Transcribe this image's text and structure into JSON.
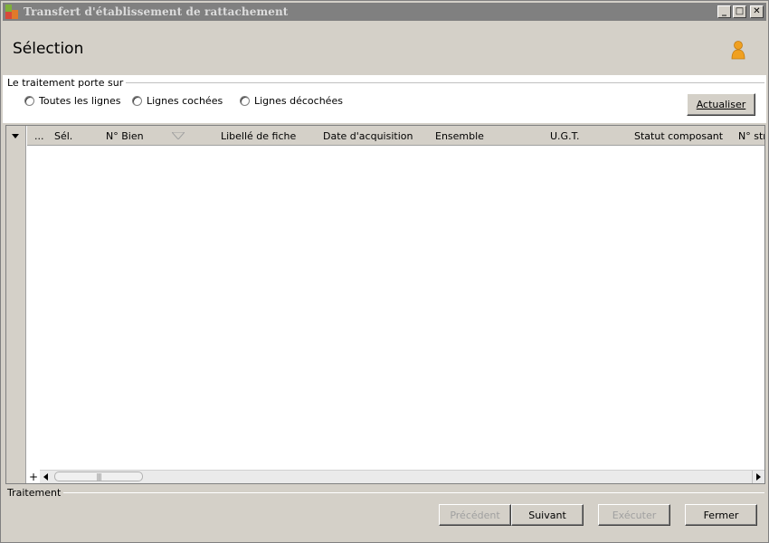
{
  "window": {
    "title": "Transfert d'établissement de rattachement",
    "controls": [
      "_",
      "□",
      "✕"
    ]
  },
  "header": {
    "title": "Sélection",
    "user_icon": "user-icon"
  },
  "scope": {
    "legend": "Le traitement porte sur",
    "options": [
      "Toutes les lignes",
      "Lignes cochées",
      "Lignes décochées"
    ],
    "refresh_label": "Actualiser"
  },
  "grid": {
    "columns": [
      "...",
      "Sél.",
      "N° Bien",
      "Libellé de fiche",
      "Date d'acquisition",
      "Ensemble",
      "U.G.T.",
      "Statut composant",
      "N° str"
    ],
    "rows": [],
    "add_label": "+",
    "scroll_thumb_grip": "|||"
  },
  "process": {
    "legend": "Traitement",
    "buttons": {
      "previous": "Précédent",
      "next": "Suivant",
      "execute": "Exécuter",
      "close": "Fermer"
    }
  },
  "colors": {
    "face": "#d4d0c8",
    "titlebar": "#808080",
    "accent_user": "#f0a020"
  }
}
